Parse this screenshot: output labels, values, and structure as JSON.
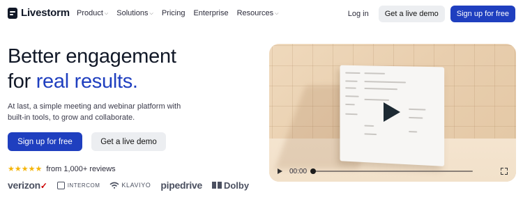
{
  "brand": {
    "name": "Livestorm"
  },
  "nav": {
    "items": [
      {
        "label": "Product",
        "has_dropdown": true
      },
      {
        "label": "Solutions",
        "has_dropdown": true
      },
      {
        "label": "Pricing",
        "has_dropdown": false
      },
      {
        "label": "Enterprise",
        "has_dropdown": false
      },
      {
        "label": "Resources",
        "has_dropdown": true
      }
    ],
    "login_label": "Log in",
    "demo_label": "Get a live demo",
    "signup_label": "Sign up for free"
  },
  "hero": {
    "headline_line1": "Better engagement",
    "headline_line2_prefix": "for ",
    "headline_accent": "real results.",
    "subtitle": "At last, a simple meeting and webinar platform with built-in tools, to grow and collaborate.",
    "primary_cta": "Sign up for free",
    "secondary_cta": "Get a live demo",
    "stars": "★★★★★",
    "reviews_text": "from 1,000+ reviews",
    "rating_stars": 5
  },
  "logos": {
    "verizon": "verizon",
    "intercom": "INTERCOM",
    "klaviyo": "KLAVIYO",
    "pipedrive": "pipedrive",
    "dolby": "Dolby"
  },
  "video": {
    "time": "00:00",
    "progress": 0
  },
  "colors": {
    "accent": "#1f3fbf",
    "star": "#f5b50a",
    "secondary_button": "#eceef1"
  }
}
